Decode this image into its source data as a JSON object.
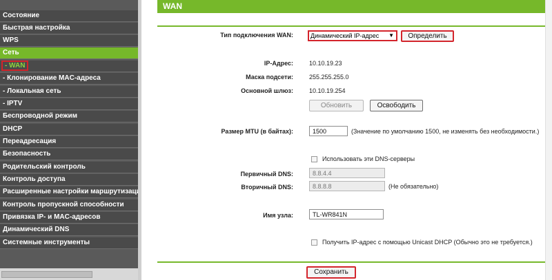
{
  "sidebar": {
    "items": [
      {
        "label": "Состояние"
      },
      {
        "label": "Быстрая настройка"
      },
      {
        "label": "WPS"
      },
      {
        "label": "Сеть"
      },
      {
        "label": "- WAN"
      },
      {
        "label": "- Клонирование MAC-адреса"
      },
      {
        "label": "- Локальная сеть"
      },
      {
        "label": "- IPTV"
      },
      {
        "label": "Беспроводной режим"
      },
      {
        "label": "DHCP"
      },
      {
        "label": "Переадресация"
      },
      {
        "label": "Безопасность"
      },
      {
        "label": "Родительский контроль"
      },
      {
        "label": "Контроль доступа"
      },
      {
        "label": "Расширенные настройки маршрутизации"
      },
      {
        "label": "Контроль пропускной способности"
      },
      {
        "label": "Привязка IP- и MAC-адресов"
      },
      {
        "label": "Динамический DNS"
      },
      {
        "label": "Системные инструменты"
      }
    ]
  },
  "page": {
    "title": "WAN"
  },
  "form": {
    "wan_type_label": "Тип подключения WAN:",
    "wan_type_value": "Динамический IP-адрес",
    "detect_button": "Определить",
    "ip_label": "IP-Адрес:",
    "ip_value": "10.10.19.23",
    "mask_label": "Маска подсети:",
    "mask_value": "255.255.255.0",
    "gateway_label": "Основной шлюз:",
    "gateway_value": "10.10.19.254",
    "renew_button": "Обновить",
    "release_button": "Освободить",
    "mtu_label": "Размер MTU (в байтах):",
    "mtu_value": "1500",
    "mtu_hint": "(Значение по умолчанию 1500, не изменять без необходимости.)",
    "use_dns_label": "Использовать эти DNS-серверы",
    "primary_dns_label": "Первичный DNS:",
    "primary_dns_value": "8.8.4.4",
    "secondary_dns_label": "Вторичный DNS:",
    "secondary_dns_value": "8.8.8.8",
    "optional_hint": "(Не обязательно)",
    "hostname_label": "Имя узла:",
    "hostname_value": "TL-WR841N",
    "unicast_label": "Получить IP-адрес с помощью Unicast DHCP (Обычно это не требуется.)",
    "save_button": "Сохранить"
  },
  "colors": {
    "accent": "#76b82a",
    "highlight": "#d3242b",
    "sidebar_bg": "#4a4a4a"
  }
}
